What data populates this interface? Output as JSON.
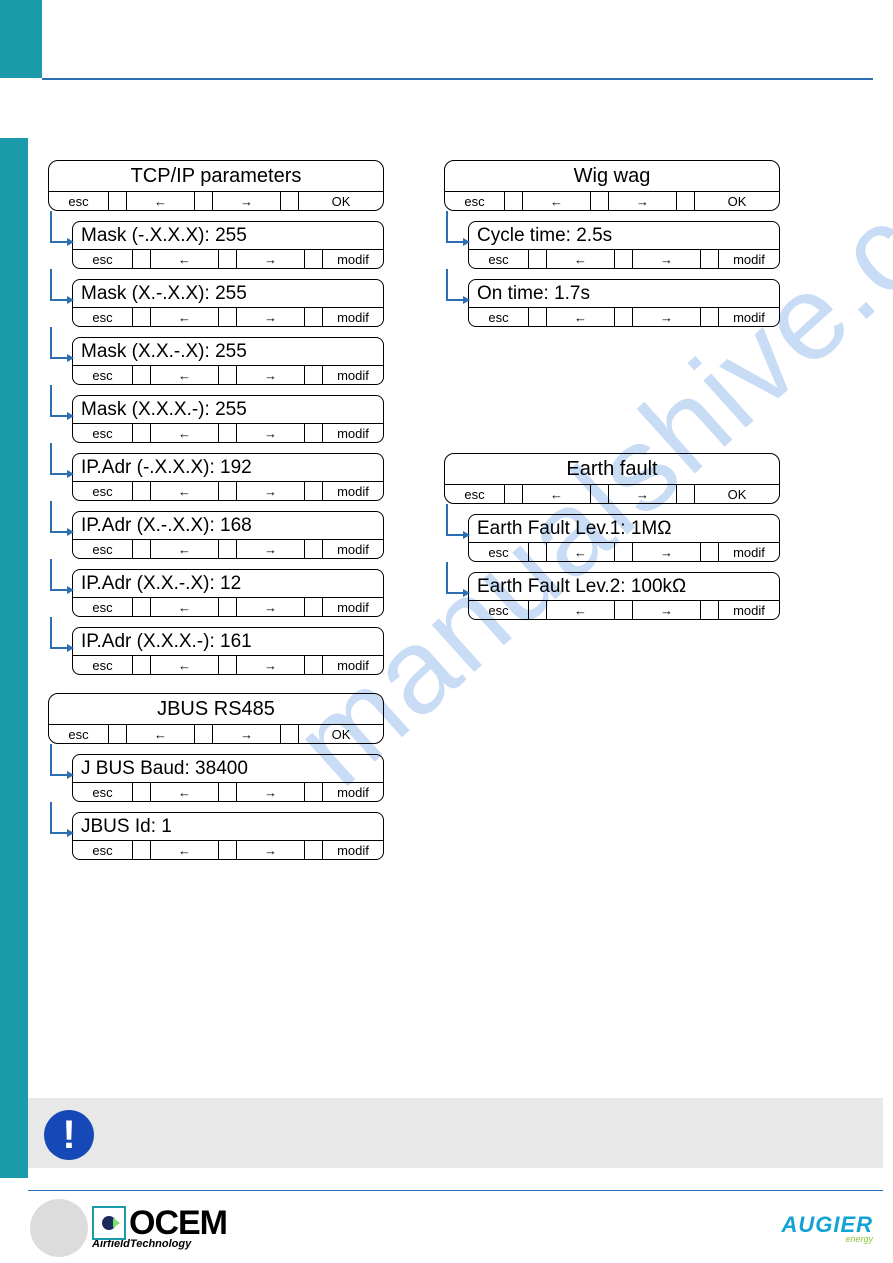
{
  "buttons": {
    "esc": "esc",
    "left": "←",
    "right": "→",
    "ok": "OK",
    "modif": "modif"
  },
  "left_col": [
    {
      "title": "TCP/IP parameters",
      "header_right": "ok",
      "items": [
        "Mask (-.X.X.X): 255",
        "Mask (X.-.X.X): 255",
        "Mask (X.X.-.X): 255",
        "Mask (X.X.X.-): 255",
        "IP.Adr (-.X.X.X): 192",
        "IP.Adr (X.-.X.X): 168",
        "IP.Adr (X.X.-.X): 12",
        "IP.Adr (X.X.X.-): 161"
      ]
    },
    {
      "title": "JBUS RS485",
      "header_right": "ok",
      "items": [
        "J BUS Baud: 38400",
        "JBUS Id: 1"
      ]
    }
  ],
  "right_col": [
    {
      "title": "Wig wag",
      "header_right": "ok",
      "items": [
        "Cycle time: 2.5s",
        "On time: 1.7s"
      ]
    },
    {
      "spacer": true
    },
    {
      "title": "Earth fault",
      "header_right": "ok",
      "items": [
        "Earth Fault Lev.1: 1MΩ",
        "Earth Fault Lev.2: 100kΩ"
      ]
    }
  ],
  "footer": {
    "ocem": "OCEM",
    "ocem_sub": "AirfieldTechnology",
    "augier": "AUGIER",
    "augier_sub": "energy"
  },
  "watermark": "manualshive.com",
  "notice_icon": "!"
}
